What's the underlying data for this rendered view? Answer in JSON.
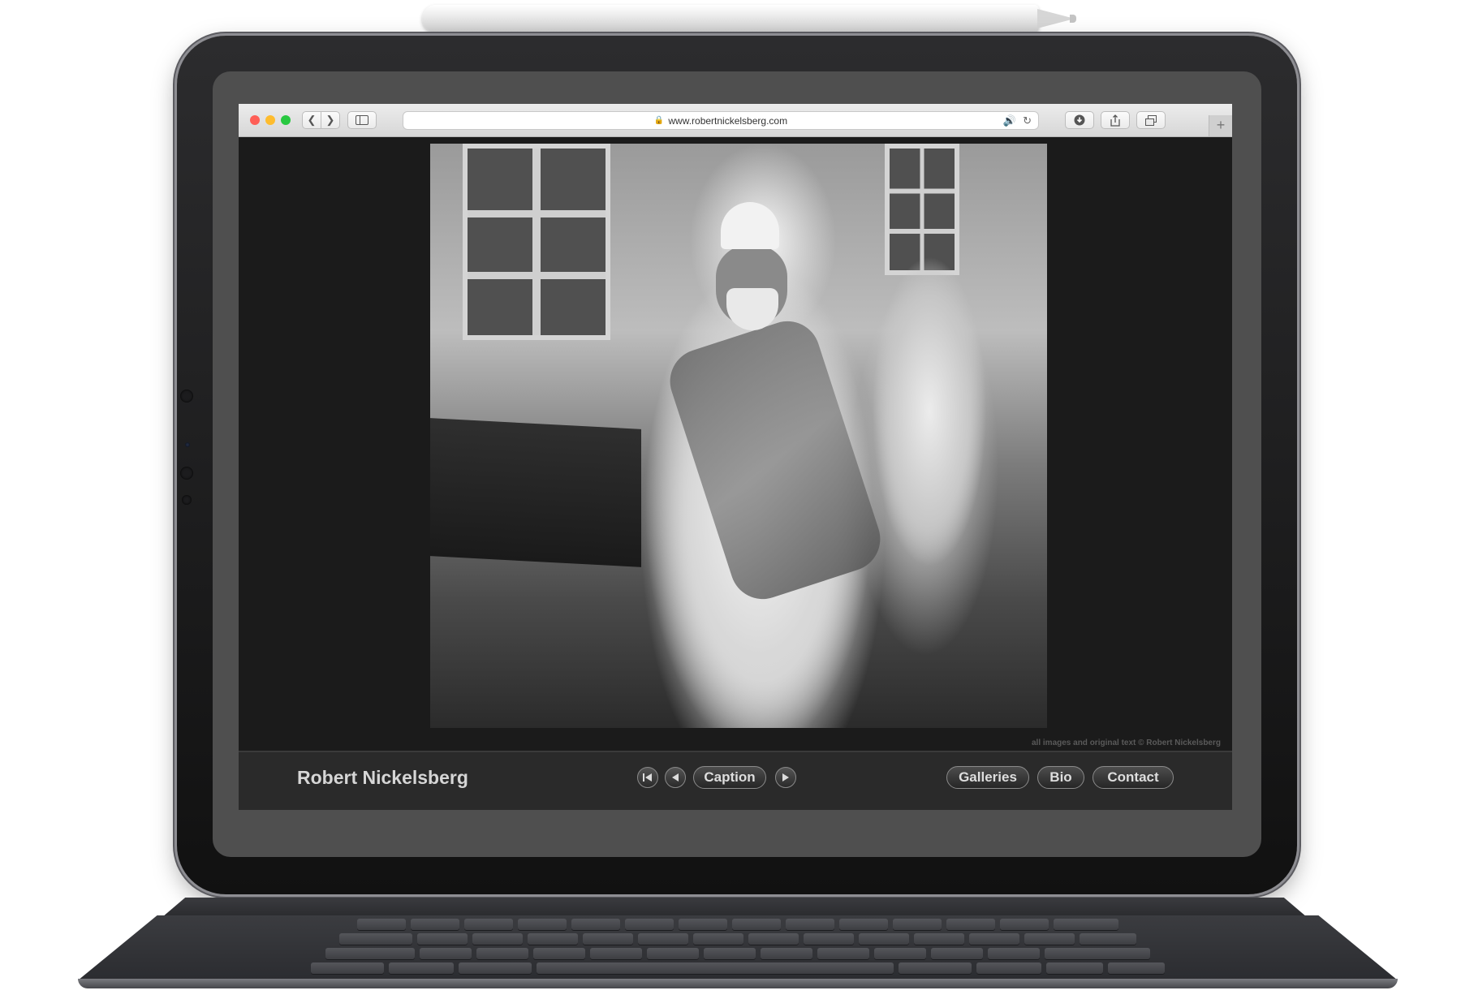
{
  "browser": {
    "url": "www.robertnickelsberg.com",
    "window_controls": [
      "close",
      "minimize",
      "zoom"
    ],
    "toolbar_icons": [
      "back-icon",
      "forward-icon",
      "sidebar-icon",
      "lock-icon",
      "speaker-icon",
      "reload-icon",
      "download-icon",
      "share-icon",
      "tabs-icon",
      "new-tab-icon"
    ]
  },
  "site": {
    "brand": "Robert Nickelsberg",
    "credit": "all images and original text © Robert Nickelsberg",
    "slideshow": {
      "caption_label": "Caption",
      "controls": [
        "first-icon",
        "previous-icon",
        "next-icon"
      ]
    },
    "nav": [
      {
        "label": "Galleries"
      },
      {
        "label": "Bio"
      },
      {
        "label": "Contact"
      }
    ]
  },
  "colors": {
    "traffic_close": "#ff5f57",
    "traffic_minimize": "#febc2e",
    "traffic_zoom": "#28c840",
    "speaker_accent": "#1a73e8"
  }
}
